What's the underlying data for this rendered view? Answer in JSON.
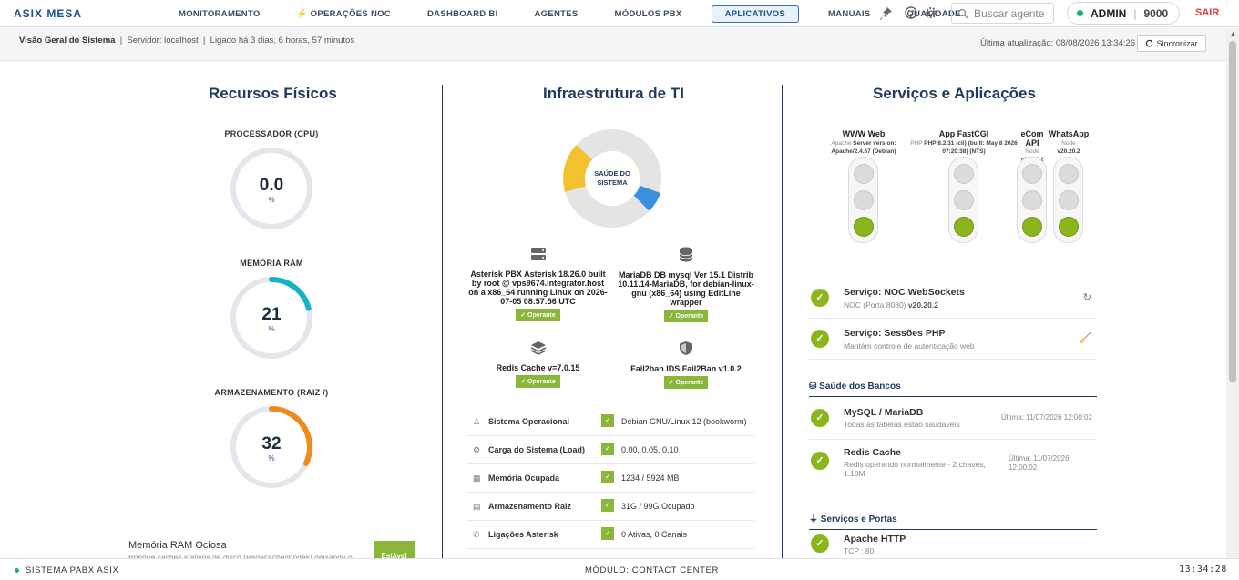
{
  "brand": "ASIX MESA",
  "nav": [
    "MONITORAMENTO",
    "⚡ OPERAÇÕES NOC",
    "DASHBOARD BI",
    "AGENTES",
    "MÓDULOS PBX",
    "APLICATIVOS",
    "MANUAIS",
    "QUALIDADE"
  ],
  "nav_active": "APLICATIVOS",
  "search": {
    "placeholder": "Buscar agente"
  },
  "user": {
    "name": "ADMIN",
    "ext": "9000"
  },
  "logout": "SAIR",
  "subbar": {
    "title": "Visão Geral do Sistema",
    "server": "Servidor: localhost",
    "uptime": "Ligado há 3 dias, 6 horas, 57 minutos",
    "last_update": "Última atualização: 08/08/2026 13:34:26",
    "sync": "Sincronizar"
  },
  "physical": {
    "title": "Recursos Físicos",
    "gauges": [
      {
        "label": "PROCESSADOR (CPU)",
        "value": "0.0",
        "unit": "%",
        "percent": 0,
        "color": "#cfd6de"
      },
      {
        "label": "MEMÓRIA RAM",
        "value": "21",
        "unit": "%",
        "percent": 21,
        "color": "#17b3c4"
      },
      {
        "label": "ARMAZENAMENTO (RAIZ /)",
        "value": "32",
        "unit": "%",
        "percent": 32,
        "color": "#f08a1c"
      }
    ],
    "idle_title": "Memória RAM Ociosa",
    "idle_desc": "Bonque caches inativos de disco (Pagecache/inodes) deixando o",
    "stable": "Estável"
  },
  "infra": {
    "title": "Infraestrutura de TI",
    "donut_label_1": "SAÚDE DO",
    "donut_label_2": "SISTEMA",
    "services": [
      {
        "icon": "server-icon",
        "name": "Asterisk PBX Asterisk 18.26.0 built by root @ vps9674.integrator.host on a x86_64 running Linux on 2026-07-05 08:57:56 UTC",
        "status": "✓ Operante"
      },
      {
        "icon": "database-icon",
        "name": "MariaDB DB mysql Ver 15.1 Distrib 10.11.14-MariaDB, for debian-linux-gnu (x86_64) using EditLine wrapper",
        "status": "✓ Operante"
      },
      {
        "icon": "layers-icon",
        "name": "Redis Cache v=7.0.15",
        "status": "✓ Operante"
      },
      {
        "icon": "shield-icon",
        "name": "Fail2ban IDS Fail2Ban v1.0.2",
        "status": "✓ Operante"
      }
    ],
    "rows": [
      {
        "icon": "linux-icon",
        "label": "Sistema Operacional",
        "value": "Debian GNU/Linux 12 (bookworm)"
      },
      {
        "icon": "cpu-icon",
        "label": "Carga do Sistema (Load)",
        "value": "0.00, 0.05, 0.10"
      },
      {
        "icon": "memory-icon",
        "label": "Memória Ocupada",
        "value": "1234 / 5924 MB"
      },
      {
        "icon": "disk-icon",
        "label": "Armazenamento Raiz",
        "value": "31G / 99G Ocupado"
      },
      {
        "icon": "phone-icon",
        "label": "Ligações Asterisk",
        "value": "0 Ativas, 0 Canais"
      }
    ]
  },
  "apps": {
    "title": "Serviços e Aplicações",
    "lights": [
      {
        "name": "WWW Web",
        "sub": "Apache",
        "sub_bold": "Server version: Apache/2.4.67 (Debian)"
      },
      {
        "name": "App FastCGI",
        "sub": "PHP",
        "sub_bold": "PHP 8.2.31 (cli) (built: May 8 2026 07:20:38) (NTS)"
      },
      {
        "name": "eCom API",
        "sub": "Node",
        "sub_bold": "v20.20.2"
      },
      {
        "name": "WhatsApp",
        "sub": "Node",
        "sub_bold": "v20.20.2"
      }
    ],
    "services": [
      {
        "title": "Serviço: NOC WebSockets",
        "desc": "NOC (Porta 8080)",
        "desc_bold": "v20.20.2",
        "action": "refresh-icon"
      },
      {
        "title": "Serviço: Sessões PHP",
        "desc": "Mantém controle de autenticação web",
        "desc_bold": "",
        "action": "broom-icon"
      }
    ],
    "db_head": "Saúde dos Bancos",
    "dbs": [
      {
        "title": "MySQL / MariaDB",
        "desc": "Todas as tabelas estao saudaveis",
        "ts": "Última: 11/07/2026 12:00:02"
      },
      {
        "title": "Redis Cache",
        "desc": "Redis operando normalmente - 2 chaves, 1.18M",
        "ts": "Última: 11/07/2026 12:00:02"
      }
    ],
    "ports_head": "Serviços e Portas",
    "ports": [
      {
        "title": "Apache HTTP",
        "desc": "TCP : 80"
      }
    ]
  },
  "footer": {
    "left": "SISTEMA PABX ASIX",
    "center": "MÓDULO: CONTACT CENTER",
    "clock": "13:34:28"
  },
  "colors": {
    "accent": "#1f4f8b",
    "ok": "#8ab61c",
    "danger": "#e03a3a"
  }
}
